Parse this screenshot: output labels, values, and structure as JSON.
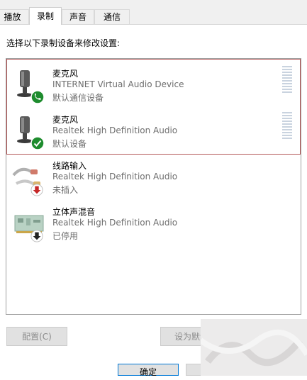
{
  "tabs": [
    {
      "label": "播放",
      "active": false
    },
    {
      "label": "录制",
      "active": true
    },
    {
      "label": "声音",
      "active": false
    },
    {
      "label": "通信",
      "active": false
    }
  ],
  "instruction": "选择以下录制设备来修改设置:",
  "devices": [
    {
      "name": "麦克风",
      "description": "INTERNET Virtual Audio Device",
      "status": "默认通信设备",
      "icon": "microphone-icon",
      "badge": "phone-icon"
    },
    {
      "name": "麦克风",
      "description": "Realtek High Definition Audio",
      "status": "默认设备",
      "icon": "microphone-icon",
      "badge": "check-icon"
    },
    {
      "name": "线路输入",
      "description": "Realtek High Definition Audio",
      "status": "未插入",
      "icon": "audio-cable-icon",
      "badge": "red-down-arrow-icon"
    },
    {
      "name": "立体声混音",
      "description": "Realtek High Definition Audio",
      "status": "已停用",
      "icon": "sound-card-icon",
      "badge": "black-down-arrow-icon"
    }
  ],
  "buttons": {
    "configure": "配置(C)",
    "set_default": "设为默认值",
    "ok": "确定"
  },
  "colors": {
    "accent": "#0078d7",
    "badge_green": "#1e8c2e",
    "badge_red": "#c62828",
    "selection_border": "#b45a5a"
  }
}
